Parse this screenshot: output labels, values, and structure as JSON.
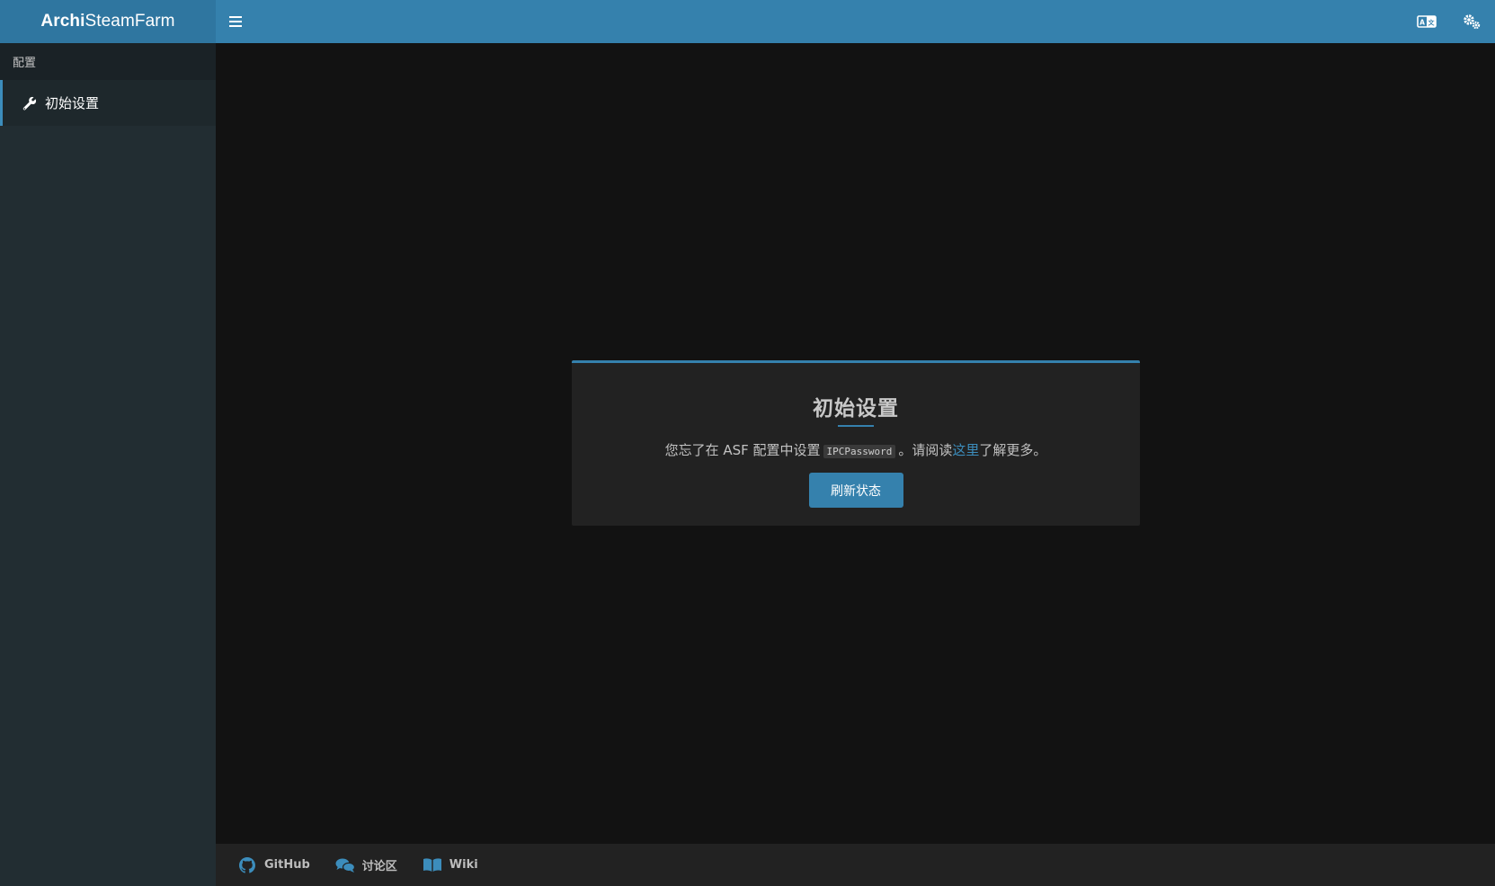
{
  "header": {
    "brand_bold": "Archi",
    "brand_rest": "SteamFarm",
    "icons": [
      "menu-icon",
      "language-icon",
      "settings-icon"
    ]
  },
  "sidebar": {
    "section_label": "配置",
    "items": [
      {
        "label": "初始设置",
        "icon": "wrench-icon"
      }
    ]
  },
  "main": {
    "card": {
      "title": "初始设置",
      "text_before": "您忘了在 ASF 配置中设置",
      "code": "IPCPassword",
      "text_middle": "。请阅读",
      "link": "这里",
      "text_after": "了解更多。",
      "button_label": "刷新状态"
    }
  },
  "footer": {
    "links": [
      {
        "label": "GitHub",
        "icon": "github-icon"
      },
      {
        "label": "讨论区",
        "icon": "comments-icon"
      },
      {
        "label": "Wiki",
        "icon": "book-icon"
      }
    ]
  },
  "colors": {
    "accent": "#3581ad",
    "brand_bg": "#2f76a0",
    "sidebar_bg": "#222d32",
    "main_bg": "#121212",
    "card_bg": "#222222",
    "link": "#3c8dbc"
  }
}
